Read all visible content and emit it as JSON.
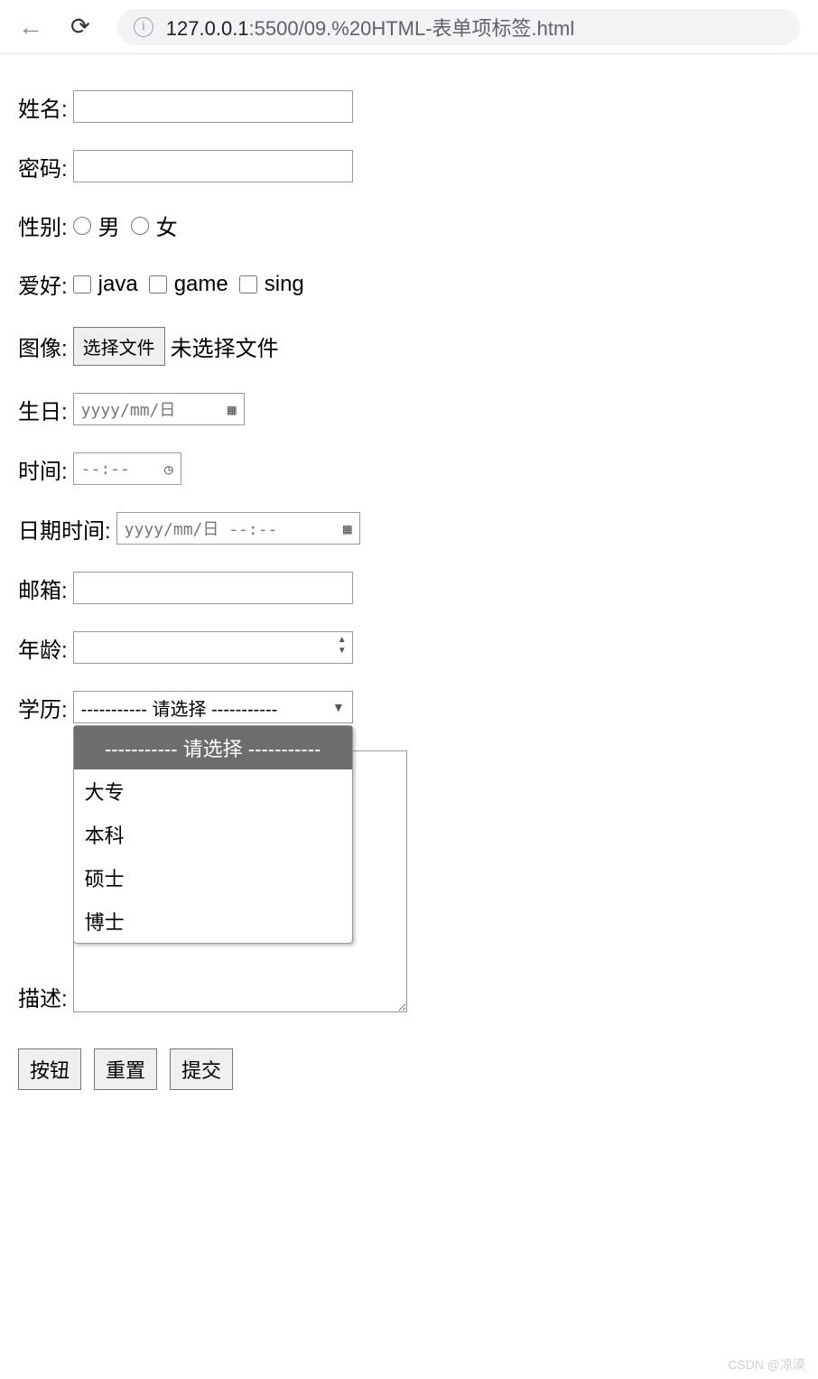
{
  "browser": {
    "url_host": "127.0.0.1",
    "url_path": ":5500/09.%20HTML-表单项标签.html"
  },
  "form": {
    "name_label": "姓名:",
    "password_label": "密码:",
    "gender": {
      "label": "性别:",
      "male": "男",
      "female": "女"
    },
    "hobby": {
      "label": "爱好:",
      "options": [
        "java",
        "game",
        "sing"
      ]
    },
    "image": {
      "label": "图像:",
      "button": "选择文件",
      "status": "未选择文件"
    },
    "birthday": {
      "label": "生日:",
      "placeholder": "yyyy/mm/日"
    },
    "time": {
      "label": "时间:",
      "placeholder": "--:--"
    },
    "datetime": {
      "label": "日期时间:",
      "placeholder": "yyyy/mm/日 --:--"
    },
    "email_label": "邮箱:",
    "age_label": "年龄:",
    "education": {
      "label": "学历:",
      "selected": "----------- 请选择 -----------",
      "options": [
        "----------- 请选择 -----------",
        "大专",
        "本科",
        "硕士",
        "博士"
      ]
    },
    "description_label": "描述:",
    "buttons": {
      "button": "按钮",
      "reset": "重置",
      "submit": "提交"
    }
  },
  "watermark": "CSDN @凉漠"
}
